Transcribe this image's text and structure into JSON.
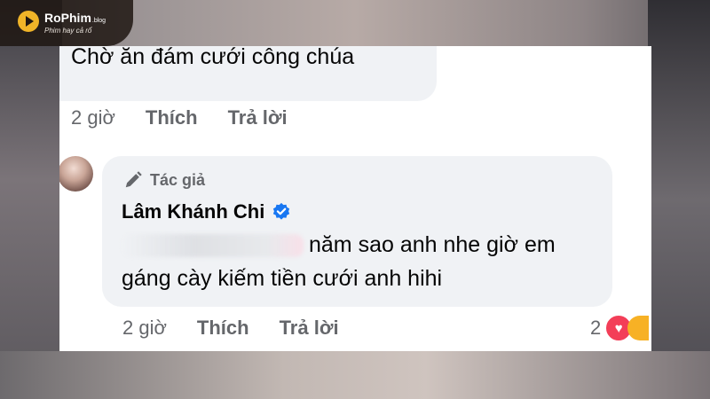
{
  "watermark": {
    "title": "RoPhim",
    "suffix": ".blog",
    "tagline": "Phim hay cả rổ"
  },
  "top_comment": {
    "text": "Chờ ăn đám cưới công chúa",
    "time": "2 giờ",
    "like_label": "Thích",
    "reply_label": "Trả lời"
  },
  "reply": {
    "author_badge": "Tác giả",
    "author_name": "Lâm Khánh Chi",
    "line1": "năm sao anh nhe giờ em",
    "line2": "gáng cày kiếm tiền cưới anh hihi",
    "time": "2 giờ",
    "like_label": "Thích",
    "reply_label": "Trả lời",
    "reaction_count": "2",
    "reaction_icons": [
      "heart-icon",
      "haha-icon"
    ]
  },
  "colors": {
    "bubble": "#f0f2f5",
    "secondary_text": "#65676b",
    "verified": "#1877f2",
    "heart": "#f33e58",
    "haha": "#f7b125",
    "logo_accent": "#f0b428"
  }
}
